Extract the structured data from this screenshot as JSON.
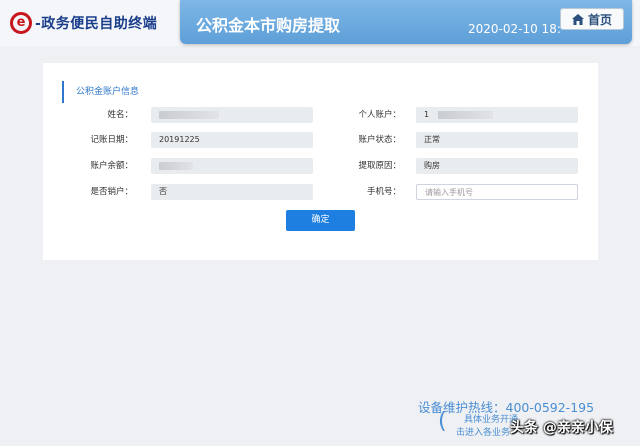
{
  "header": {
    "logo_mark": "e",
    "logo_text": "-政务便民自助终端",
    "title": "公积金本市购房提取",
    "datetime": "2020-02-10 18:",
    "home_label": "首页"
  },
  "card": {
    "section_title": "公积金账户信息",
    "rows": [
      {
        "left_label": "姓名：",
        "left_value": "",
        "right_label": "个人账户：",
        "right_value": "1"
      },
      {
        "left_label": "记账日期：",
        "left_value": "20191225",
        "right_label": "账户状态：",
        "right_value": "正常"
      },
      {
        "left_label": "账户余额：",
        "left_value": "",
        "right_label": "提取原因：",
        "right_value": "购房"
      },
      {
        "left_label": "是否销户：",
        "left_value": "否",
        "right_label": "手机号：",
        "right_placeholder": "请输入手机号"
      }
    ],
    "confirm_label": "确定"
  },
  "footer": {
    "hotline": "设备维护热线：400-0592-195",
    "tip_line1": "具体业务开通",
    "tip_line2": "击进入各业务",
    "watermark": "头条 @亲亲小保"
  },
  "colors": {
    "accent": "#1f7fe0",
    "banner": "#6aa9de",
    "logo_red": "#c8161d",
    "logo_blue": "#1a3e8c"
  }
}
